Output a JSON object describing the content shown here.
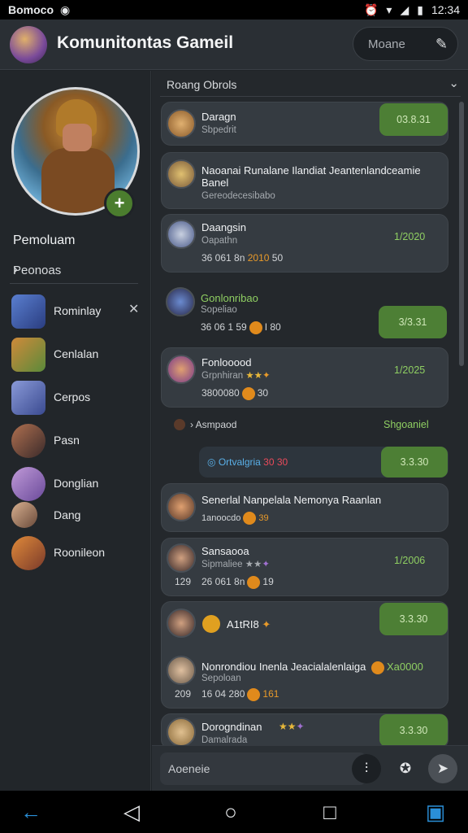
{
  "status_bar": {
    "carrier": "Bomoco",
    "time": "12:34"
  },
  "header": {
    "title": "Komunitontas Gameil",
    "search_label": "Moane"
  },
  "sidebar": {
    "section_label": "Pemoluam",
    "section_row": "Peonoas",
    "items": [
      {
        "label": "Rominlay"
      },
      {
        "label": "Cenlalan"
      },
      {
        "label": "Cerpos"
      },
      {
        "label": "Pasn"
      },
      {
        "label": "Donglian"
      },
      {
        "label": "Dang"
      },
      {
        "label": "Roonileon"
      }
    ]
  },
  "main": {
    "filter_label": "Roang Obrols",
    "cards": [
      {
        "name": "Daragn",
        "sub": "Sbpedrit",
        "amount": "03.8.31"
      },
      {
        "name": "Naoanai Runalane Ilandiat Jeantenlandceamie Banel",
        "sub": "Gereodecesibabo"
      },
      {
        "name": "Daangsin",
        "sub": "Oapathn",
        "meta_num": "36 061 8n",
        "meta_hi": "2010",
        "meta_val": "50",
        "amount": "1/2020"
      },
      {
        "name": "Gonlonribao",
        "sub": "Sopeliao",
        "meta_num": "36 06 1 59",
        "meta_val": "I 80",
        "amount": "3/3.31"
      },
      {
        "name": "Fonlooood",
        "sub": "Grpnhiran",
        "meta_num": "3800080",
        "meta_val": "30",
        "amount": "1/2025"
      },
      {
        "name": "Asmpaod",
        "right_text": "Shgoaniel"
      },
      {
        "name": "Ortvalgria",
        "badge": "30 30",
        "amount": "3.3.30"
      },
      {
        "name": "Senerlal Nanpelala Nemonya Raanlan",
        "meta_num": "1anoocdo",
        "meta_val": "39"
      },
      {
        "name": "Sansaooa",
        "sub": "Sipmaliee",
        "meta_num": "26 061 8n",
        "meta_left": "129",
        "meta_val": "19",
        "amount": "1/2006"
      },
      {
        "name": "A1tRI8",
        "amount": "3.3.30"
      },
      {
        "name": "Nonrondiou Inenla Jeacialalenlaiga",
        "green": "Xa0000",
        "sub": "Sepoloan",
        "meta_left": "209",
        "meta_num": "16 04 280",
        "meta_val": "161"
      },
      {
        "name": "Dorogndinan",
        "sub": "Damalrada",
        "amount": "3.3.30"
      }
    ]
  },
  "composer": {
    "placeholder": "Aoeneie"
  },
  "colors": {
    "accent_green": "#4d7f35",
    "nav_blue": "#2a8fd8"
  }
}
